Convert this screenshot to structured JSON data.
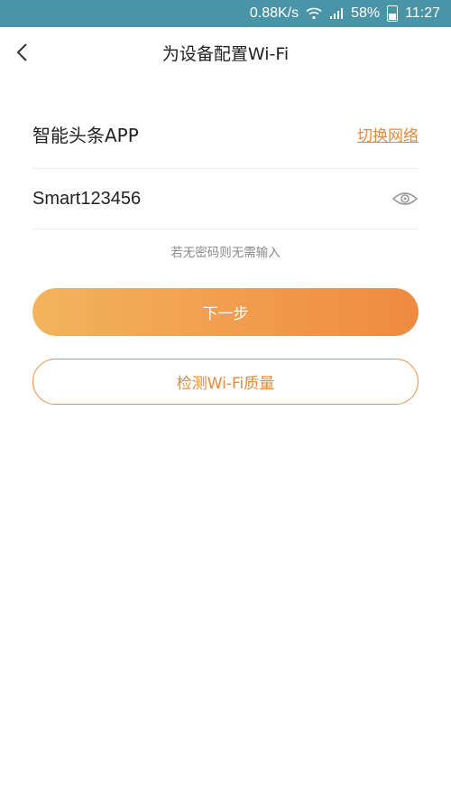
{
  "status_bar": {
    "speed": "0.88K/s",
    "battery": "58%",
    "time": "11:27"
  },
  "header": {
    "title": "为设备配置Wi-Fi"
  },
  "wifi": {
    "ssid": "智能头条APP",
    "switch_label": "切换网络",
    "password": "Smart123456",
    "hint": "若无密码则无需输入"
  },
  "actions": {
    "next_label": "下一步",
    "check_label": "检测Wi-Fi质量"
  },
  "colors": {
    "accent": "#e8883a",
    "status_bar_bg": "#4a94a8"
  }
}
